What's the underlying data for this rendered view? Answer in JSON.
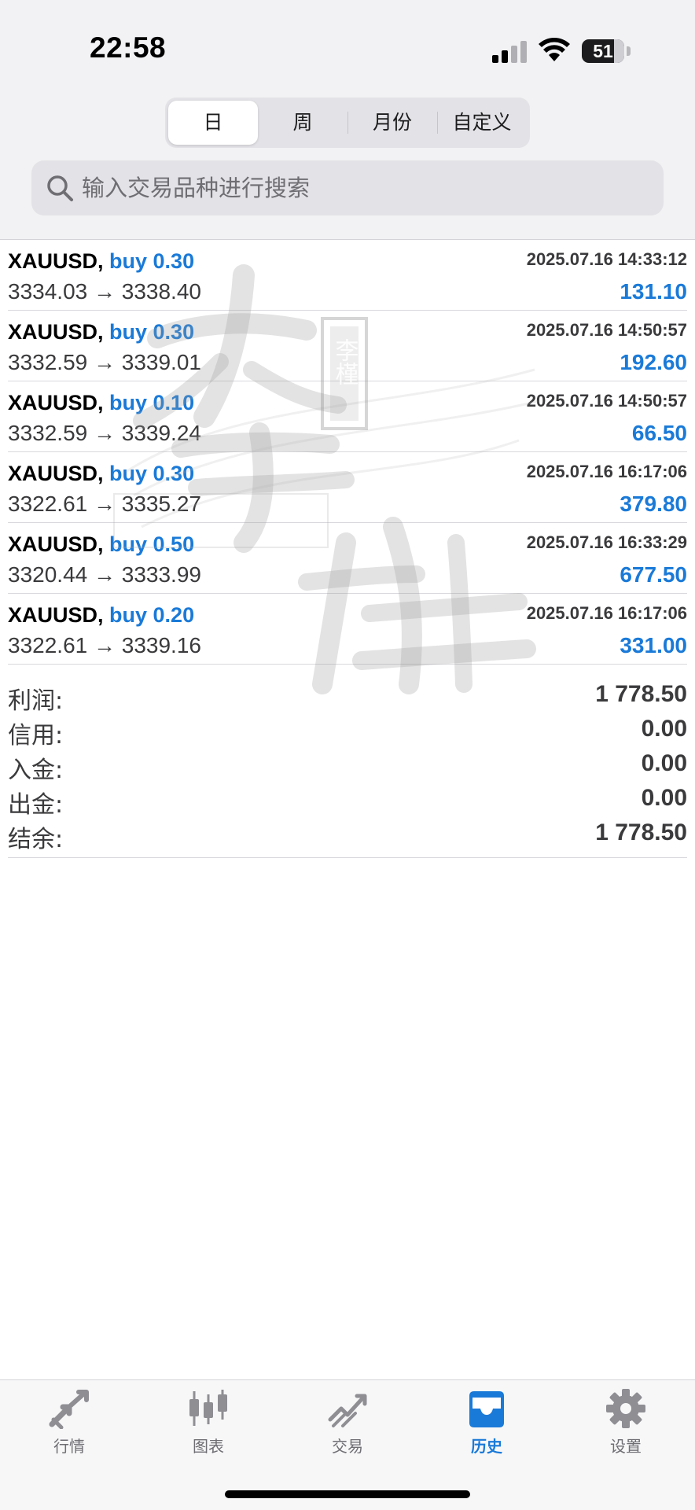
{
  "status_bar": {
    "time": "22:58",
    "battery": "51"
  },
  "segments": [
    {
      "label": "日",
      "active": true
    },
    {
      "label": "周",
      "active": false
    },
    {
      "label": "月份",
      "active": false
    },
    {
      "label": "自定义",
      "active": false
    }
  ],
  "search": {
    "placeholder": "输入交易品种进行搜索"
  },
  "watermark": {
    "chars": "李槿"
  },
  "trades": [
    {
      "symbol": "XAUUSD,",
      "side": "buy 0.30",
      "time": "2025.07.16 14:33:12",
      "prices": "3334.03 → 3338.40",
      "profit": "131.10"
    },
    {
      "symbol": "XAUUSD,",
      "side": "buy 0.30",
      "time": "2025.07.16 14:50:57",
      "prices": "3332.59 → 3339.01",
      "profit": "192.60"
    },
    {
      "symbol": "XAUUSD,",
      "side": "buy 0.10",
      "time": "2025.07.16 14:50:57",
      "prices": "3332.59 → 3339.24",
      "profit": "66.50"
    },
    {
      "symbol": "XAUUSD,",
      "side": "buy 0.30",
      "time": "2025.07.16 16:17:06",
      "prices": "3322.61 → 3335.27",
      "profit": "379.80"
    },
    {
      "symbol": "XAUUSD,",
      "side": "buy 0.50",
      "time": "2025.07.16 16:33:29",
      "prices": "3320.44 → 3333.99",
      "profit": "677.50"
    },
    {
      "symbol": "XAUUSD,",
      "side": "buy 0.20",
      "time": "2025.07.16 16:17:06",
      "prices": "3322.61 → 3339.16",
      "profit": "331.00"
    }
  ],
  "summary": [
    {
      "label": "利润:",
      "value": "1 778.50"
    },
    {
      "label": "信用:",
      "value": "0.00"
    },
    {
      "label": "入金:",
      "value": "0.00"
    },
    {
      "label": "出金:",
      "value": "0.00"
    },
    {
      "label": "结余:",
      "value": "1 778.50"
    }
  ],
  "tabbar": [
    {
      "label": "行情",
      "icon": "quotes-arrows-icon",
      "active": false
    },
    {
      "label": "图表",
      "icon": "candlestick-chart-icon",
      "active": false
    },
    {
      "label": "交易",
      "icon": "trade-chart-icon",
      "active": false
    },
    {
      "label": "历史",
      "icon": "history-inbox-icon",
      "active": true
    },
    {
      "label": "设置",
      "icon": "gear-icon",
      "active": false
    }
  ],
  "colors": {
    "accent": "#1a7ad8",
    "icon_gray": "#8e8e93"
  }
}
